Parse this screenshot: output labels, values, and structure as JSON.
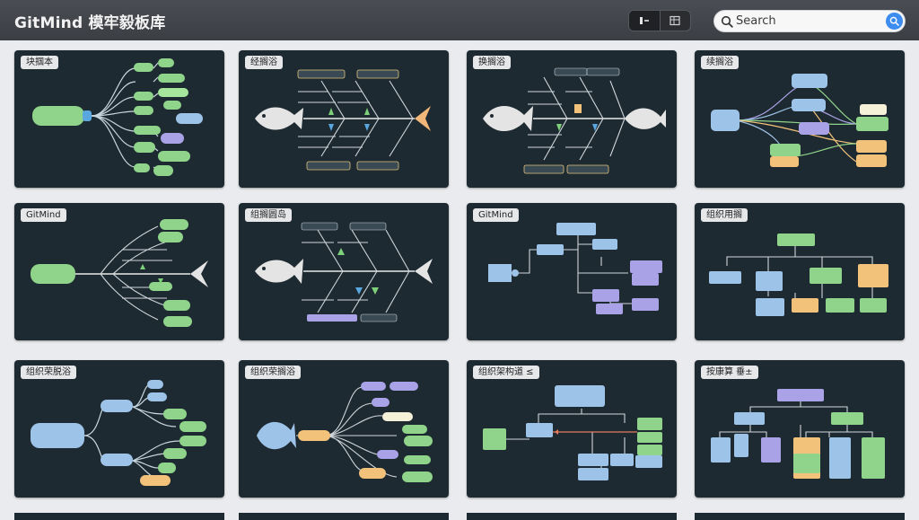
{
  "app": {
    "title": "GitMind 模牢毅板库"
  },
  "search": {
    "placeholder": "Search"
  },
  "toolbar": {
    "view_modes": [
      "gallery-view",
      "list-view"
    ]
  },
  "colors": {
    "topbar": "#404348",
    "card_bg": "#1e2a31",
    "accent_blue": "#3d8cf0",
    "node_green": "#8fd48a",
    "node_blue": "#9ec3e8",
    "node_purple": "#a9a2e6",
    "node_orange": "#f2c27a"
  },
  "cards": [
    {
      "label": "块掴本",
      "type": "mindmap"
    },
    {
      "label": "经搁浴",
      "type": "fishbone"
    },
    {
      "label": "换搁浴",
      "type": "fishbone"
    },
    {
      "label": "续搁浴",
      "type": "network"
    },
    {
      "label": "GitMind",
      "type": "fishbone-left"
    },
    {
      "label": "组搁圆岛",
      "type": "fishbone"
    },
    {
      "label": "GitMind",
      "type": "flow"
    },
    {
      "label": "组织用搁",
      "type": "org"
    },
    {
      "label": "组织荣脱浴",
      "type": "mindmap"
    },
    {
      "label": "组织荣搁浴",
      "type": "fishbone-tree"
    },
    {
      "label": "组织架构道 ≤",
      "type": "flow"
    },
    {
      "label": "按康算 垂±",
      "type": "org"
    }
  ]
}
